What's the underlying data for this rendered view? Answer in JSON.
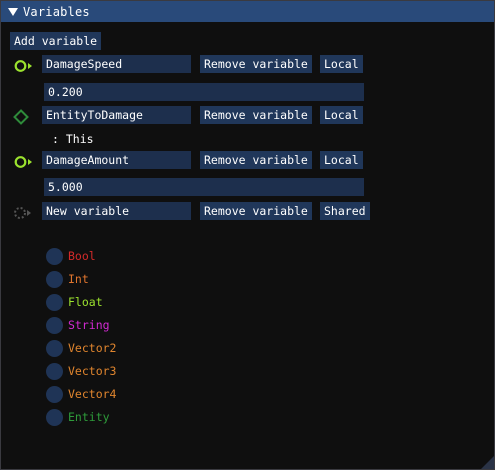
{
  "window": {
    "title": "Variables"
  },
  "toolbar": {
    "add_variable_label": "Add variable"
  },
  "variables": [
    {
      "name": "DamageSpeed",
      "remove_label": "Remove variable",
      "scope_label": "Local",
      "value": "0.200",
      "pin_icon": "float-pin-icon",
      "pin_color": "#9be22e"
    },
    {
      "name": "EntityToDamage",
      "remove_label": "Remove variable",
      "scope_label": "Local",
      "value": ": This",
      "pin_icon": "entity-pin-icon",
      "pin_color": "#2e8b3a"
    },
    {
      "name": "DamageAmount",
      "remove_label": "Remove variable",
      "scope_label": "Local",
      "value": "5.000",
      "pin_icon": "float-pin-icon",
      "pin_color": "#9be22e"
    },
    {
      "name": "New variable",
      "remove_label": "Remove variable",
      "scope_label": "Shared",
      "pin_icon": "unset-pin-icon",
      "pin_color": "#666666"
    }
  ],
  "type_options": [
    {
      "label": "Bool",
      "color": "#d42a2a"
    },
    {
      "label": "Int",
      "color": "#e0752e"
    },
    {
      "label": "Float",
      "color": "#9be22e"
    },
    {
      "label": "String",
      "color": "#d22ad2"
    },
    {
      "label": "Vector2",
      "color": "#e0852e"
    },
    {
      "label": "Vector3",
      "color": "#e0852e"
    },
    {
      "label": "Vector4",
      "color": "#e0852e"
    },
    {
      "label": "Entity",
      "color": "#2e9b3a"
    }
  ]
}
